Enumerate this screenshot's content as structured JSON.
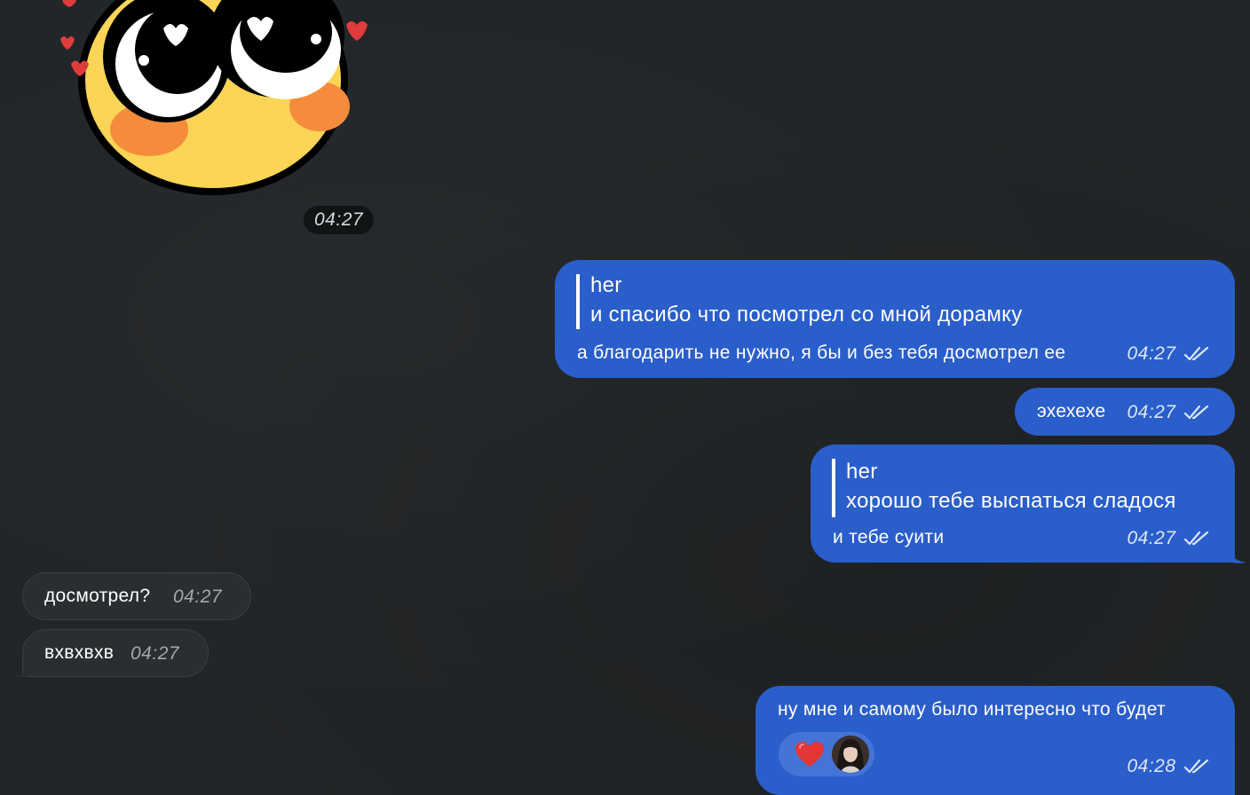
{
  "chat": {
    "sticker": {
      "time": "04:27"
    },
    "messages": [
      {
        "direction": "outgoing",
        "reply_name": "her",
        "reply_text": "и спасибо что посмотрел со мной дорамку",
        "text": "а благодарить не нужно, я бы и без тебя досмотрел ее",
        "time": "04:27"
      },
      {
        "direction": "outgoing",
        "text": "эхехехе",
        "time": "04:27"
      },
      {
        "direction": "outgoing",
        "reply_name": "her",
        "reply_text": "хорошо тебе выспаться сладося",
        "text": "и тебе суити",
        "time": "04:27"
      },
      {
        "direction": "incoming",
        "text": "досмотрел?",
        "time": "04:27"
      },
      {
        "direction": "incoming",
        "text": "вхвхвхв",
        "time": "04:27"
      },
      {
        "direction": "outgoing",
        "text": "ну мне и самому было интересно что будет",
        "time": "04:28",
        "reactions": [
          "heart-icon",
          "avatar"
        ]
      }
    ]
  },
  "colors": {
    "background": "#222527",
    "outgoing_bubble": "#2a5ecb",
    "incoming_bubble": "#2b2e31",
    "reaction_pill": "#4574d6",
    "heart": "#e53535"
  }
}
